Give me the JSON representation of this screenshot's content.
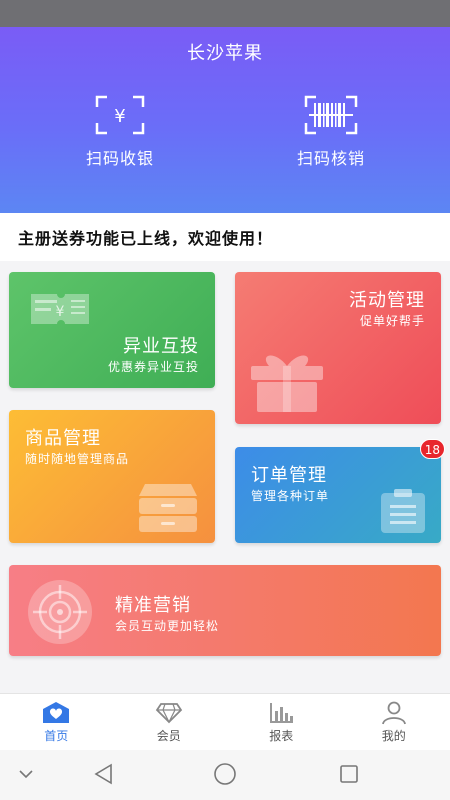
{
  "header": {
    "title": "长沙苹果",
    "scan_pay_label": "扫码收银",
    "scan_verify_label": "扫码核销"
  },
  "notice": {
    "text": "主册送券功能已上线，欢迎使用！"
  },
  "cards": {
    "yiye": {
      "title": "异业互投",
      "subtitle": "优惠券异业互投"
    },
    "huodong": {
      "title": "活动管理",
      "subtitle": "促单好帮手"
    },
    "shangpin": {
      "title": "商品管理",
      "subtitle": "随时随地管理商品"
    },
    "dingdan": {
      "title": "订单管理",
      "subtitle": "管理各种订单",
      "badge": "18"
    },
    "jingzhun": {
      "title": "精准营销",
      "subtitle": "会员互动更加轻松"
    }
  },
  "tabbar": {
    "items": [
      {
        "label": "首页",
        "icon": "home-icon",
        "active": true
      },
      {
        "label": "会员",
        "icon": "diamond-icon",
        "active": false
      },
      {
        "label": "报表",
        "icon": "bar-chart-icon",
        "active": false
      },
      {
        "label": "我的",
        "icon": "user-icon",
        "active": false
      }
    ]
  },
  "colors": {
    "header_top": "#7a5cf6",
    "header_bottom": "#5c86f3",
    "active_tab": "#3478e5",
    "badge": "#e8262d"
  }
}
